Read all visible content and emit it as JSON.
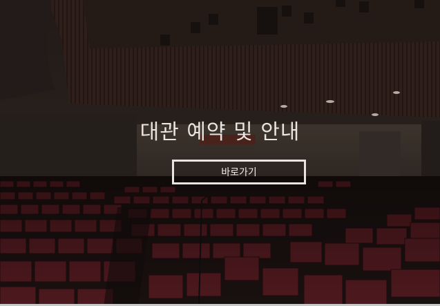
{
  "hero": {
    "title": "대관 예약 및 안내",
    "button_label": "바로가기"
  },
  "colors": {
    "text": "#e9e4df",
    "button_border": "#e8e4e0",
    "seat": "#6b2228",
    "wood": "#3a2620"
  }
}
